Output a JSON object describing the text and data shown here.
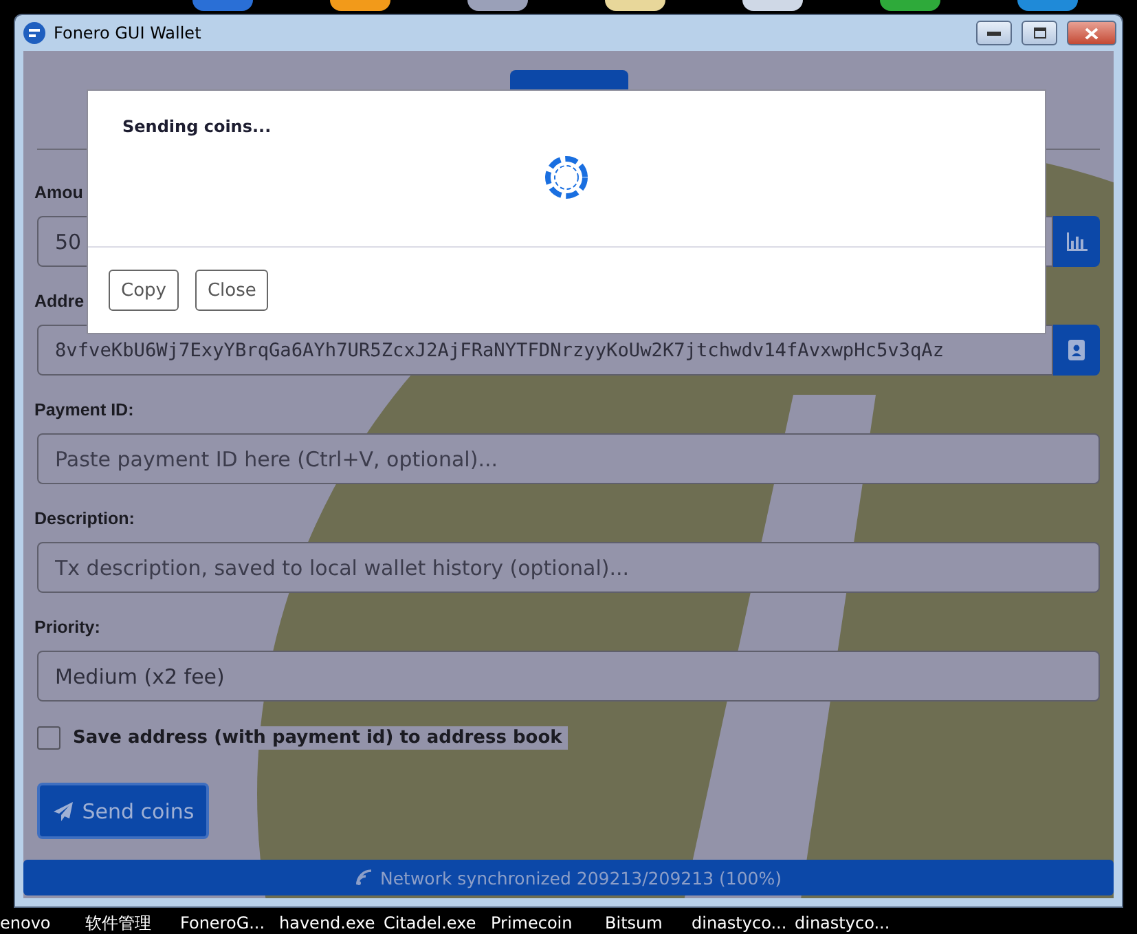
{
  "window": {
    "title": "Fonero GUI Wallet"
  },
  "form": {
    "fields": [
      {
        "kind": "amount",
        "label": "Amou",
        "value": "50"
      },
      {
        "kind": "address",
        "label": "Addre",
        "value": "8vfveKbU6Wj7ExyYBrqGa6AYh7UR5ZcxJ2AjFRaNYTFDNrzyyKoUw2K7jtchwdv14fAvxwpHc5v3qAz"
      },
      {
        "kind": "text",
        "label": "Payment ID:",
        "placeholder": "Paste payment ID here (Ctrl+V, optional)..."
      },
      {
        "kind": "text",
        "label": "Description:",
        "placeholder": "Tx description, saved to local wallet history (optional)..."
      },
      {
        "kind": "select",
        "label": "Priority:",
        "value": "Medium (x2 fee)"
      }
    ],
    "save_to_address_book": {
      "label": "Save address (with payment id) to address book",
      "checked": false
    },
    "send_button": "Send coins"
  },
  "dialog": {
    "title": "Sending coins...",
    "buttons": [
      "Copy",
      "Close"
    ]
  },
  "status_bar": {
    "text": "Network synchronized 209213/209213 (100%)"
  },
  "taskbar": {
    "items": [
      "enovo",
      "软件管理",
      "FoneroG...",
      "havend.exe",
      "Citadel.exe",
      "Primecoin",
      "Bitsum",
      "dinastyco...",
      "dinastyco..."
    ]
  }
}
